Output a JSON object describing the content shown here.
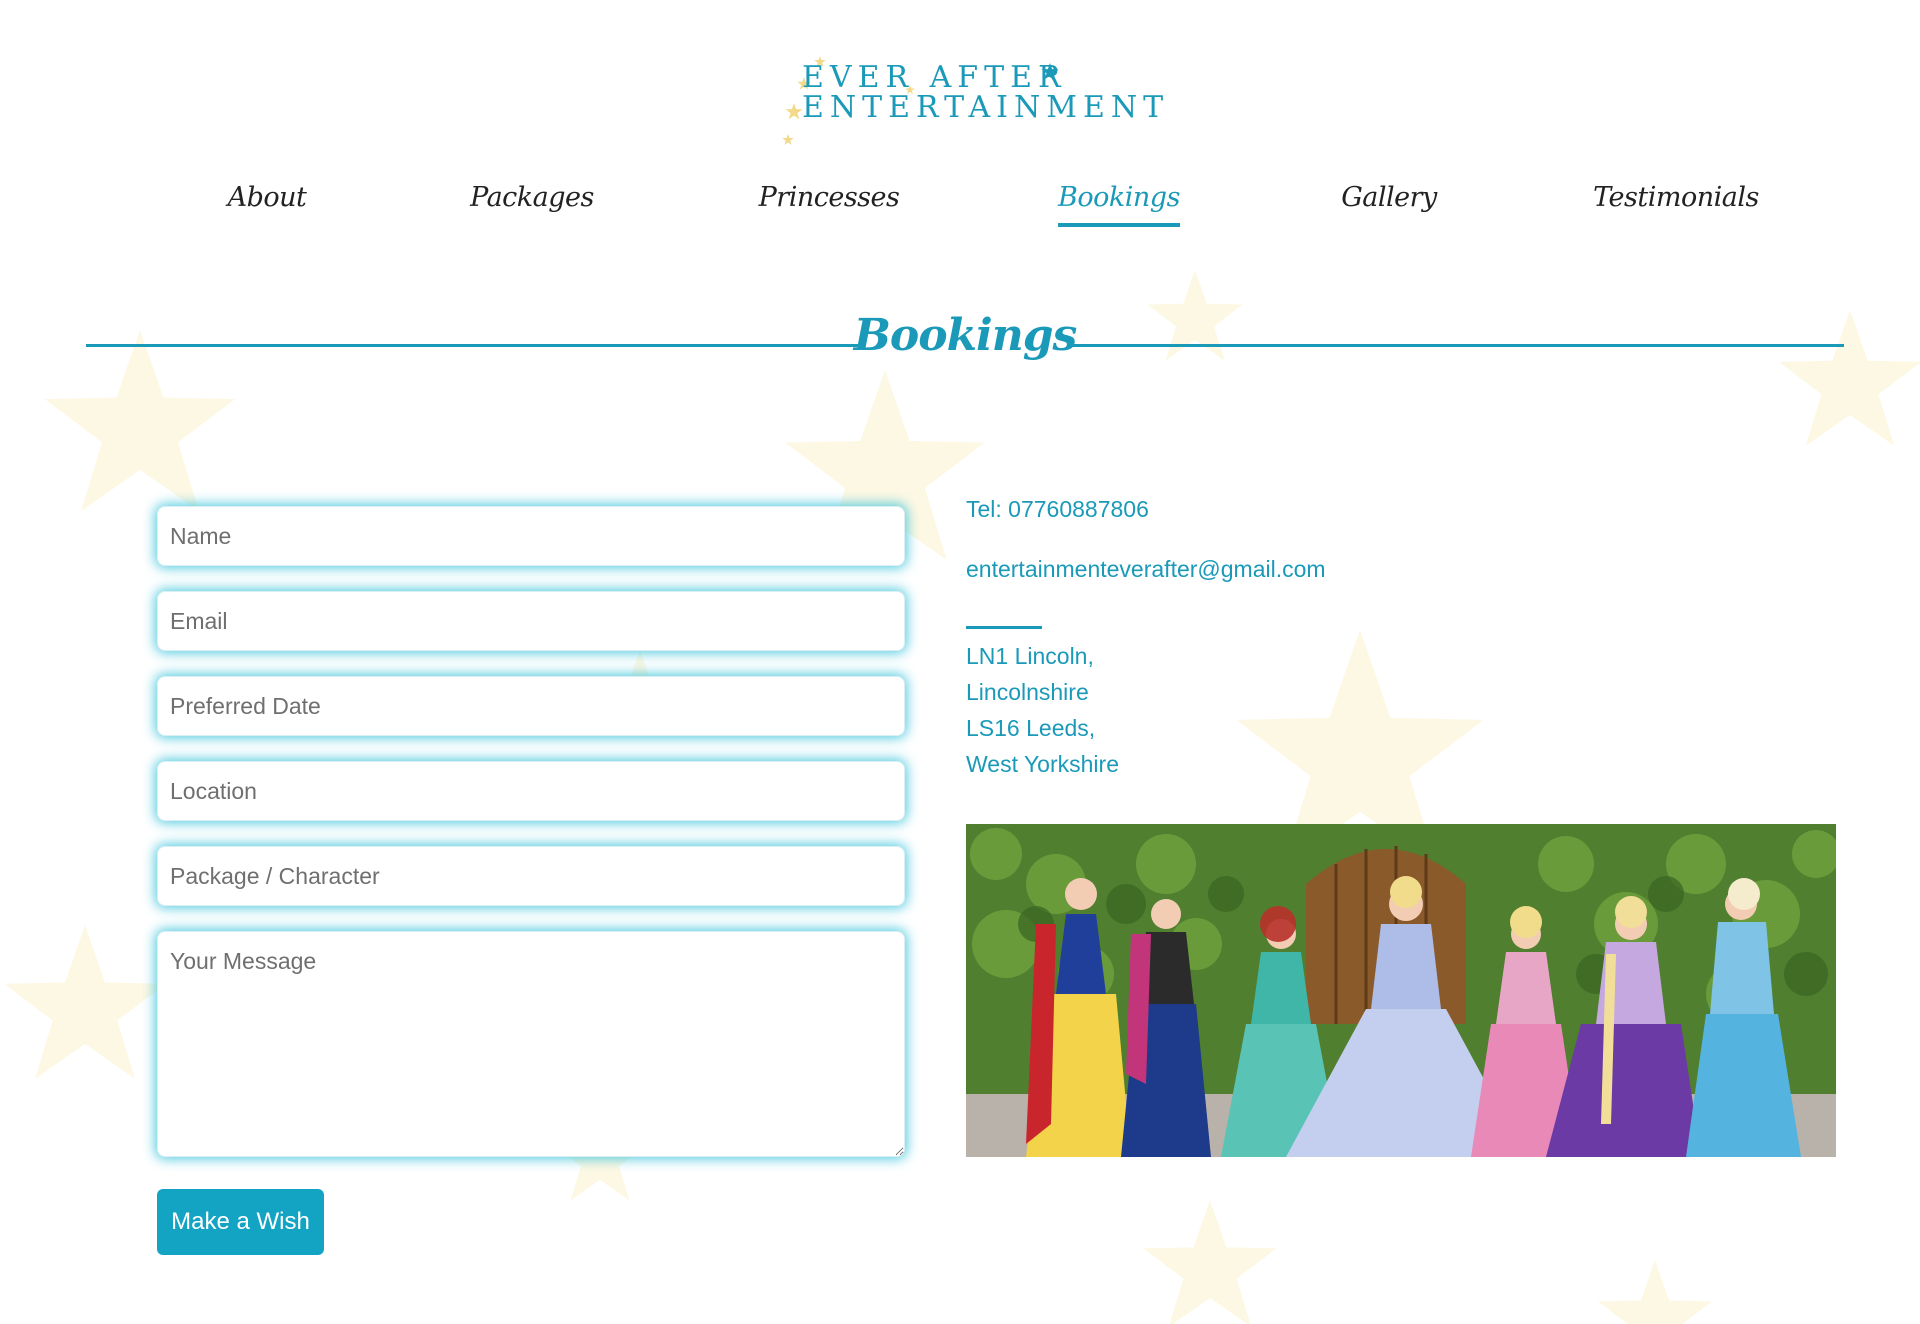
{
  "brand": {
    "line1": "EVER AFTER",
    "line2": "ENTERTAINMENT",
    "accent_color": "#1a9ab8",
    "star_color": "#f3d98a"
  },
  "nav": {
    "items": [
      {
        "label": "About",
        "active": false
      },
      {
        "label": "Packages",
        "active": false
      },
      {
        "label": "Princesses",
        "active": false
      },
      {
        "label": "Bookings",
        "active": true
      },
      {
        "label": "Gallery",
        "active": false
      },
      {
        "label": "Testimonials",
        "active": false
      }
    ]
  },
  "section": {
    "title": "Bookings"
  },
  "form": {
    "name_placeholder": "Name",
    "email_placeholder": "Email",
    "date_placeholder": "Preferred Date",
    "location_placeholder": "Location",
    "package_placeholder": "Package / Character",
    "message_placeholder": "Your Message",
    "submit_label": "Make a Wish",
    "button_color": "#13a3c3",
    "glow_color": "#1abad6"
  },
  "contact": {
    "tel": "Tel: 07760887806",
    "email": "entertainmenteverafter@gmail.com",
    "address_lines": [
      "LN1 Lincoln,",
      "Lincolnshire",
      "LS16 Leeds,",
      "West Yorkshire"
    ]
  },
  "photo": {
    "icon": "princesses-group-photo"
  }
}
